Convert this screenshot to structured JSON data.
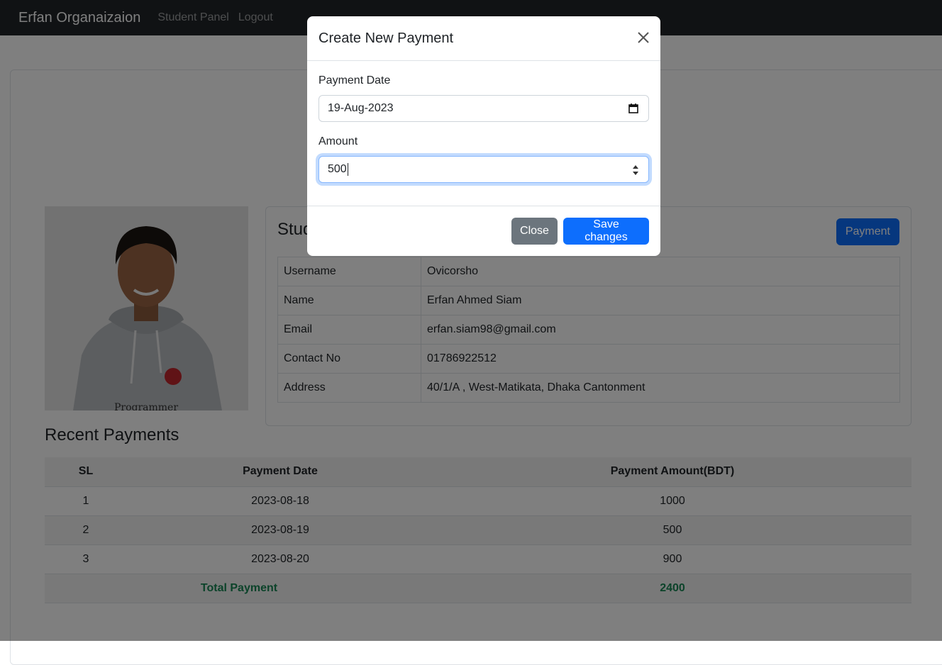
{
  "navbar": {
    "brand": "Erfan Organaizaion",
    "links": [
      "Student Panel",
      "Logout"
    ]
  },
  "student": {
    "title_partial": "Stud",
    "payment_button": "Payment",
    "fields": [
      {
        "label": "Username",
        "value": "Ovicorsho"
      },
      {
        "label": "Name",
        "value": "Erfan Ahmed Siam"
      },
      {
        "label": "Email",
        "value": "erfan.siam98@gmail.com"
      },
      {
        "label": "Contact No",
        "value": "01786922512"
      },
      {
        "label": "Address",
        "value": "40/1/A , West-Matikata, Dhaka Cantonment"
      }
    ]
  },
  "recent_payments": {
    "title": "Recent Payments",
    "headers": [
      "SL",
      "Payment Date",
      "Payment Amount(BDT)"
    ],
    "rows": [
      {
        "sl": "1",
        "date": "2023-08-18",
        "amount": "1000"
      },
      {
        "sl": "2",
        "date": "2023-08-19",
        "amount": "500"
      },
      {
        "sl": "3",
        "date": "2023-08-20",
        "amount": "900"
      }
    ],
    "total_label": "Total Payment",
    "total_value": "2400"
  },
  "modal": {
    "title": "Create New Payment",
    "payment_date_label": "Payment Date",
    "payment_date_value": "19-Aug-2023",
    "amount_label": "Amount",
    "amount_value": "500",
    "close_button": "Close",
    "save_button": "Save changes"
  },
  "icons": {
    "close": "close-icon",
    "calendar": "calendar-icon",
    "stepper": "stepper-icon"
  },
  "colors": {
    "navbar_bg": "#212529",
    "primary": "#0d6efd",
    "secondary": "#6c757d",
    "success_text": "#198754"
  }
}
